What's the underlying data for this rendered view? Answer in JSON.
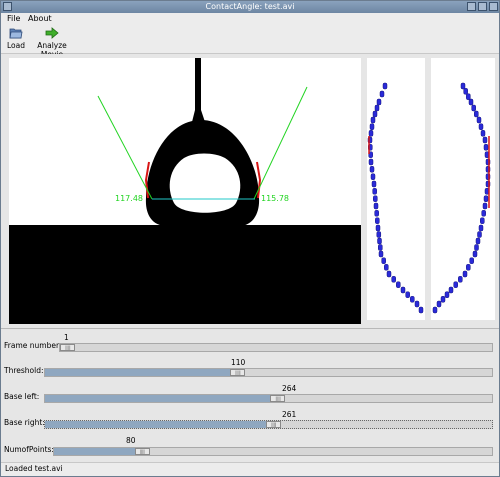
{
  "window": {
    "title": "ContactAngle: test.avi"
  },
  "menu": {
    "file": "File",
    "about": "About"
  },
  "toolbar": {
    "load_label": "Load",
    "analyze_label": "Analyze Movie"
  },
  "measurement": {
    "left_angle": "117.48",
    "right_angle": "115.78"
  },
  "sliders": [
    {
      "label": "Frame number:",
      "value": "1",
      "fraction": 0.0
    },
    {
      "label": "Threshold:",
      "value": "110",
      "fraction": 0.43
    },
    {
      "label": "Base left:",
      "value": "264",
      "fraction": 0.52
    },
    {
      "label": "Base right:",
      "value": "261",
      "fraction": 0.51
    },
    {
      "label": "NumofPoints:",
      "value": "80",
      "fraction": 0.2
    }
  ],
  "status": {
    "text": "Loaded test.avi"
  },
  "colors": {
    "fit_line": "#22d422",
    "baseline": "#22c8c8",
    "edge_red": "#d81414",
    "contour_blue": "#2a2ad8"
  },
  "icons": {
    "load": "folder-open-icon",
    "analyze": "green-arrow-icon"
  }
}
